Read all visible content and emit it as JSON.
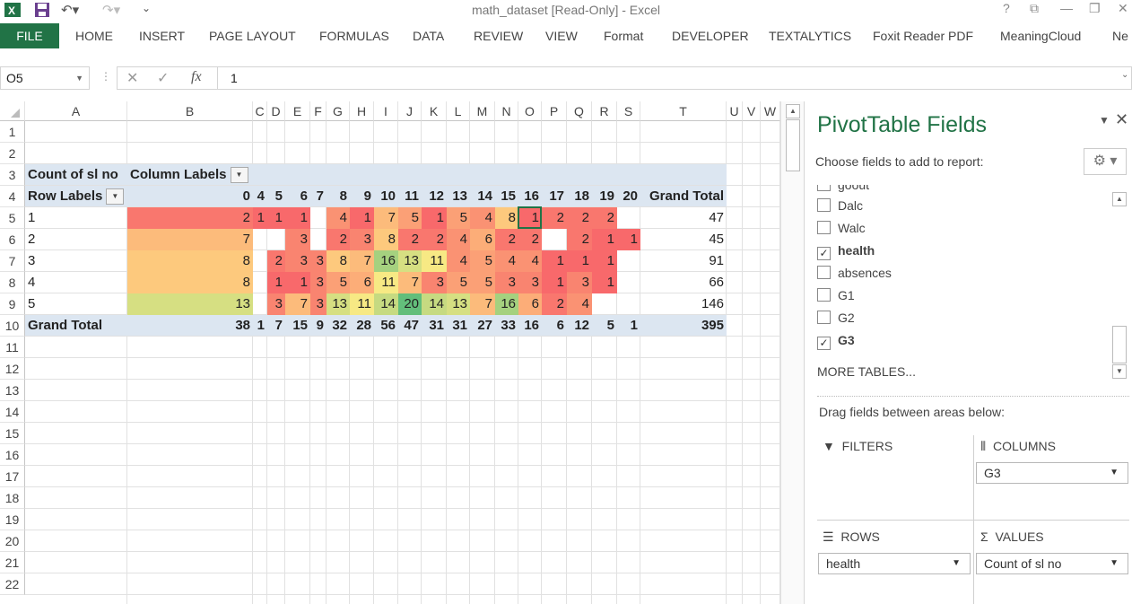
{
  "window": {
    "title": "math_dataset  [Read-Only] - Excel"
  },
  "ribbon": {
    "file": "FILE",
    "tabs": [
      "HOME",
      "INSERT",
      "PAGE LAYOUT",
      "FORMULAS",
      "DATA",
      "REVIEW",
      "VIEW",
      "Format",
      "DEVELOPER",
      "TEXTALYTICS",
      "Foxit Reader PDF",
      "MeaningCloud",
      "Ne"
    ]
  },
  "formula_bar": {
    "name_box": "O5",
    "fx": "fx",
    "value": "1"
  },
  "sheet": {
    "columns": [
      "A",
      "B",
      "C",
      "D",
      "E",
      "F",
      "G",
      "H",
      "I",
      "J",
      "K",
      "L",
      "M",
      "N",
      "O",
      "P",
      "Q",
      "R",
      "S",
      "T",
      "U",
      "V",
      "W"
    ],
    "rows": [
      "1",
      "2",
      "3",
      "4",
      "5",
      "6",
      "7",
      "8",
      "9",
      "10",
      "11",
      "12",
      "13",
      "14",
      "15",
      "16",
      "17",
      "18",
      "19",
      "20",
      "21",
      "22"
    ]
  },
  "pivot": {
    "count_label": "Count of sl no",
    "column_labels": "Column Labels",
    "row_labels": "Row Labels",
    "headers": [
      "0",
      "4",
      "5",
      "6",
      "7",
      "8",
      "9",
      "10",
      "11",
      "12",
      "13",
      "14",
      "15",
      "16",
      "17",
      "18",
      "19",
      "20"
    ],
    "grand_total_label": "Grand Total",
    "rows": [
      {
        "label": "1",
        "values": [
          "2",
          "1",
          "1",
          "1",
          "",
          "4",
          "1",
          "7",
          "5",
          "1",
          "5",
          "4",
          "8",
          "1",
          "2",
          "2",
          "2",
          ""
        ],
        "total": "47"
      },
      {
        "label": "2",
        "values": [
          "7",
          "",
          "",
          "3",
          "",
          "2",
          "3",
          "8",
          "2",
          "2",
          "4",
          "6",
          "2",
          "2",
          "",
          "2",
          "1",
          "1"
        ],
        "total": "45"
      },
      {
        "label": "3",
        "values": [
          "8",
          "",
          "2",
          "3",
          "3",
          "8",
          "7",
          "16",
          "13",
          "11",
          "4",
          "5",
          "4",
          "4",
          "1",
          "1",
          "1",
          ""
        ],
        "total": "91"
      },
      {
        "label": "4",
        "values": [
          "8",
          "",
          "1",
          "1",
          "3",
          "5",
          "6",
          "11",
          "7",
          "3",
          "5",
          "5",
          "3",
          "3",
          "1",
          "3",
          "1",
          ""
        ],
        "total": "66"
      },
      {
        "label": "5",
        "values": [
          "13",
          "",
          "3",
          "7",
          "3",
          "13",
          "11",
          "14",
          "20",
          "14",
          "13",
          "7",
          "16",
          "6",
          "2",
          "4",
          "",
          ""
        ],
        "total": "146"
      }
    ],
    "grand_totals": [
      "38",
      "1",
      "7",
      "15",
      "9",
      "32",
      "28",
      "56",
      "47",
      "31",
      "31",
      "27",
      "33",
      "16",
      "6",
      "12",
      "5",
      "1"
    ],
    "grand_total_all": "395"
  },
  "pane": {
    "title": "PivotTable Fields",
    "choose": "Choose fields to add to report:",
    "partial_field": "goout",
    "fields": [
      {
        "name": "Dalc",
        "checked": false
      },
      {
        "name": "Walc",
        "checked": false
      },
      {
        "name": "health",
        "checked": true
      },
      {
        "name": "absences",
        "checked": false
      },
      {
        "name": "G1",
        "checked": false
      },
      {
        "name": "G2",
        "checked": false
      },
      {
        "name": "G3",
        "checked": true
      }
    ],
    "check_mark": "✓",
    "more_tables": "MORE TABLES...",
    "drag_text": "Drag fields between areas below:",
    "filters": "FILTERS",
    "columns": "COLUMNS",
    "rows": "ROWS",
    "values": "VALUES",
    "columns_value": "G3",
    "rows_value": "health",
    "values_value": "Count of sl no"
  },
  "colors": {
    "accent": "#217346",
    "pivot_header": "#dce6f1",
    "heat_low": "#f8696b",
    "heat_mid": "#ffeb84",
    "heat_high": "#63be7b"
  }
}
